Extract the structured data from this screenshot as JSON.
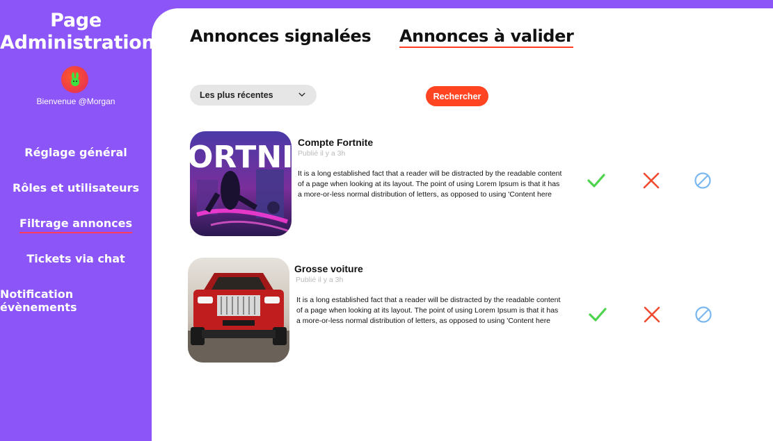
{
  "sidebar": {
    "title_line1": "Page",
    "title_line2": "Administration",
    "welcome": "Bienvenue @Morgan",
    "items": [
      {
        "label": "Réglage général",
        "active": false
      },
      {
        "label": "Rôles et utilisateurs",
        "active": false
      },
      {
        "label": "Filtrage annonces",
        "active": true
      },
      {
        "label": "Tickets via chat",
        "active": false
      },
      {
        "label": "Notification évènements",
        "active": false
      }
    ]
  },
  "tabs": [
    {
      "label": "Annonces signalées",
      "active": false
    },
    {
      "label": "Annonces à valider",
      "active": true
    }
  ],
  "filters": {
    "sort_selected": "Les plus récentes",
    "search_label": "Rechercher"
  },
  "ads": [
    {
      "title": "Compte Fortnite",
      "time": "Publié il y a 3h",
      "image_text": "ORTNIT",
      "description": "It is a long established fact that a reader will be distracted by the readable content of a page when looking at its layout. The point of using Lorem Ipsum is that it has a more-or-less normal distribution of letters, as opposed to using 'Content here"
    },
    {
      "title": "Grosse voiture",
      "time": "Publié il y a 3h",
      "description": "It is a long established fact that a reader will be distracted by the readable content of a page when looking at its layout. The point of using Lorem Ipsum is that it has a more-or-less normal distribution of letters, as opposed to using 'Content here"
    }
  ],
  "actions": {
    "approve_icon": "check-icon",
    "reject_icon": "cross-icon",
    "block_icon": "ban-icon"
  },
  "colors": {
    "sidebar_bg": "#8b55f8",
    "accent": "#ff4422",
    "approve": "#4cd44c",
    "reject": "#f04a30",
    "block": "#7ab8f0"
  }
}
